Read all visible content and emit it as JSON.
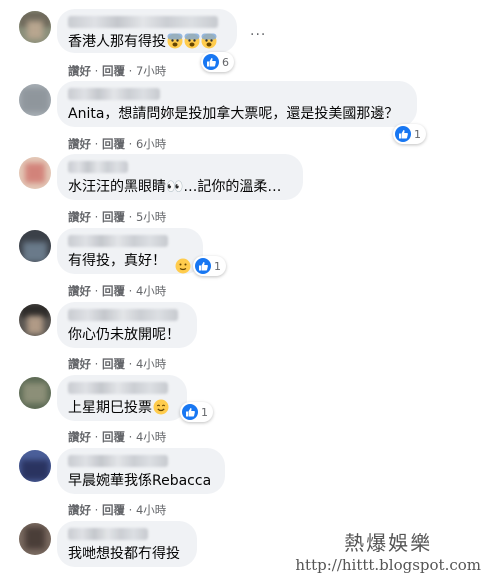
{
  "comments": [
    {
      "text": "香港人那有得投",
      "reaction_count": "6",
      "actions": {
        "like": "讚好",
        "reply": "回覆",
        "time": "7小時"
      }
    },
    {
      "text": "Anita，想請問妳是投加拿大票呢，還是投美國那邊？",
      "reaction_count": "1",
      "actions": {
        "like": "讚好",
        "reply": "回覆",
        "time": "6小時"
      }
    },
    {
      "text": "水汪汪的黑眼睛👀…記你的溫柔…",
      "actions": {
        "like": "讚好",
        "reply": "回覆",
        "time": "5小時"
      }
    },
    {
      "text": "有得投，真好！",
      "reaction_count": "1",
      "actions": {
        "like": "讚好",
        "reply": "回覆",
        "time": "4小時"
      }
    },
    {
      "text": "你心仍未放開呢！",
      "actions": {
        "like": "讚好",
        "reply": "回覆",
        "time": "4小時"
      }
    },
    {
      "text": "上星期巳投票",
      "reaction_count": "1",
      "actions": {
        "like": "讚好",
        "reply": "回覆",
        "time": "4小時"
      }
    },
    {
      "text": "早晨婉華我係Rebacca",
      "actions": {
        "like": "讚好",
        "reply": "回覆",
        "time": "4小時"
      }
    },
    {
      "text": "我哋想投都冇得投"
    }
  ],
  "more_options": "···",
  "watermark": {
    "title": "熱爆娛樂",
    "url": "http://hittt.blogspot.com"
  },
  "colors": {
    "bubble": "#f0f2f5",
    "like_blue": "#1877f2",
    "meta_gray": "#65676b"
  }
}
